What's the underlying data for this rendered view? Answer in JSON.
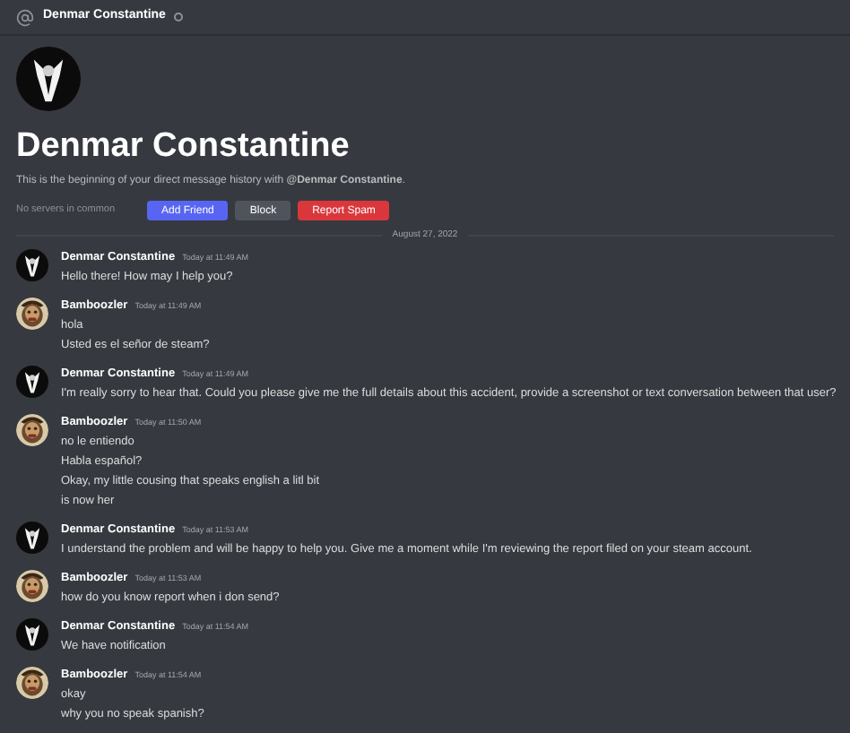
{
  "header": {
    "title": "Denmar Constantine"
  },
  "profile": {
    "name": "Denmar Constantine",
    "intro": "This is the beginning of your direct message history with **@Denmar Constantine**.",
    "mutual_servers": "No servers in common",
    "buttons": [
      {
        "label": "Add Friend",
        "kind": "primary"
      },
      {
        "label": "Block",
        "kind": "secondary"
      },
      {
        "label": "Report Spam",
        "kind": "danger"
      }
    ]
  },
  "date_divider": "August 27, 2022",
  "messages": [
    {
      "author": "Denmar Constantine",
      "kind": "tuxedo",
      "timestamp": "Today at 11:49 AM",
      "lines": [
        "Hello there! How may I help you?"
      ]
    },
    {
      "author": "Bamboozler",
      "timestamp": "Today at 11:49 AM",
      "lines": [
        "hola",
        "Usted es el señor de steam?"
      ]
    },
    {
      "author": "Denmar Constantine",
      "kind": "tuxedo",
      "timestamp": "Today at 11:49 AM",
      "lines": [
        "I'm really sorry to hear that. Could you please give me the full details about this accident, provide a screenshot or text conversation between that user?"
      ]
    },
    {
      "author": "Bamboozler",
      "timestamp": "Today at 11:50 AM",
      "lines": [
        "no le entiendo",
        "Habla español?",
        "Okay, my little cousing that speaks english a litl bit",
        "is now her"
      ]
    },
    {
      "author": "Denmar Constantine",
      "kind": "tuxedo",
      "timestamp": "Today at 11:53 AM",
      "lines": [
        "I understand the problem and will be happy to help you. Give me a moment while I'm reviewing the report filed on your steam account."
      ]
    },
    {
      "author": "Bamboozler",
      "timestamp": "Today at 11:53 AM",
      "lines": [
        "how do you know report when i don send?"
      ]
    },
    {
      "author": "Denmar Constantine",
      "kind": "tuxedo",
      "timestamp": "Today at 11:54 AM",
      "lines": [
        "We have notification"
      ]
    },
    {
      "author": "Bamboozler",
      "timestamp": "Today at 11:54 AM",
      "lines": [
        "okay",
        "why you no speak spanish?"
      ]
    }
  ]
}
